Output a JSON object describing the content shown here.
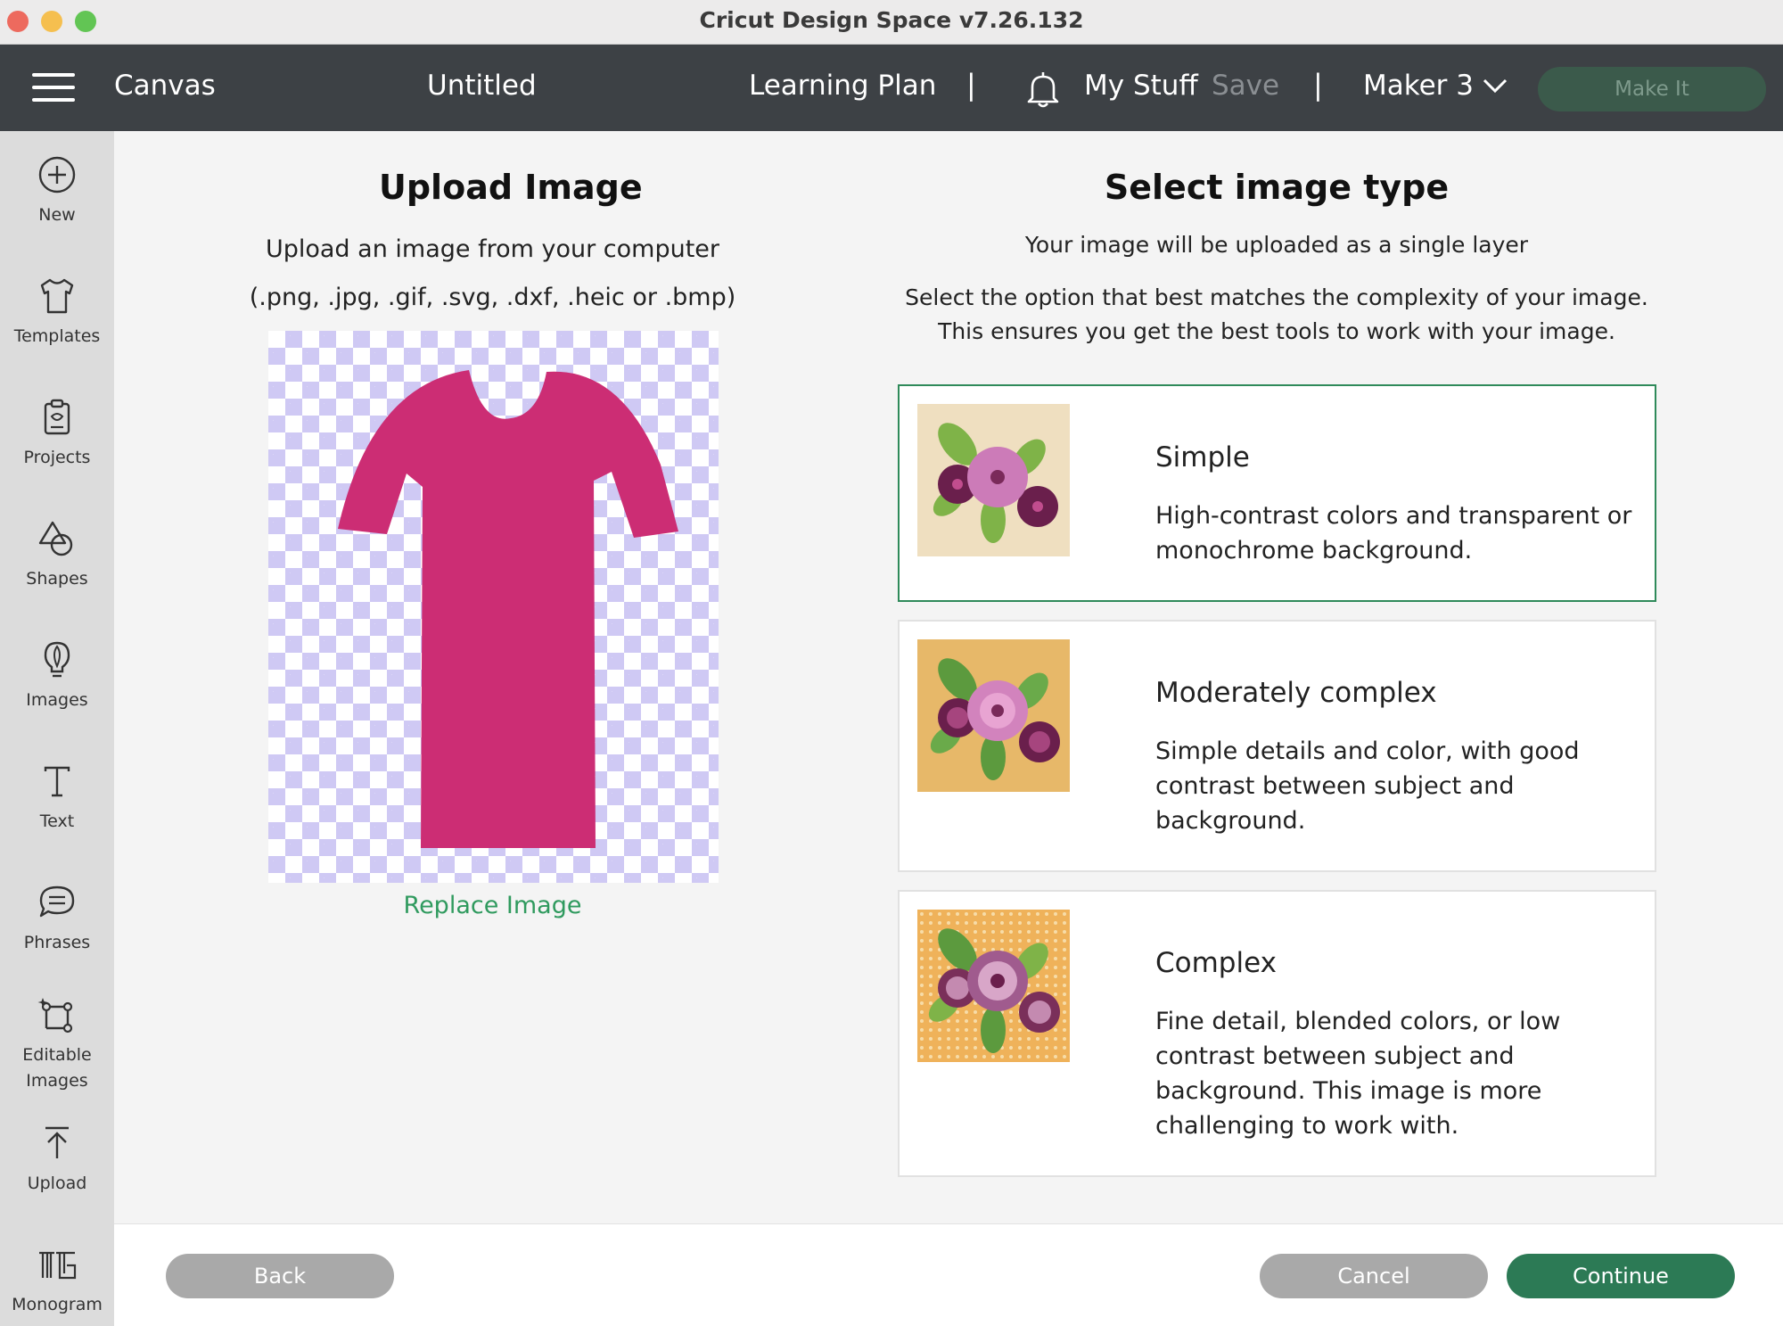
{
  "window": {
    "title": "Cricut Design Space  v7.26.132"
  },
  "header": {
    "canvas": "Canvas",
    "project_name": "Untitled",
    "learning_plan": "Learning Plan",
    "separator": "|",
    "my_stuff": "My Stuff",
    "save": "Save",
    "machine": "Maker 3",
    "make_it": "Make It"
  },
  "sidebar": {
    "items": [
      {
        "label": "New",
        "icon": "plus-circle-icon"
      },
      {
        "label": "Templates",
        "icon": "shirt-icon"
      },
      {
        "label": "Projects",
        "icon": "project-icon"
      },
      {
        "label": "Shapes",
        "icon": "shapes-icon"
      },
      {
        "label": "Images",
        "icon": "lightbulb-icon"
      },
      {
        "label": "Text",
        "icon": "text-icon"
      },
      {
        "label": "Phrases",
        "icon": "speech-bubble-icon"
      },
      {
        "label": "Editable Images",
        "label_line1": "Editable",
        "label_line2": "Images",
        "icon": "editable-image-icon"
      },
      {
        "label": "Upload",
        "icon": "upload-icon"
      },
      {
        "label": "Monogram",
        "icon": "monogram-icon"
      }
    ]
  },
  "upload": {
    "title": "Upload Image",
    "subtitle": "Upload an image from your computer",
    "formats": "(.png, .jpg, .gif, .svg, .dxf, .heic or .bmp)",
    "replace_link": "Replace Image",
    "preview_fill": "#cc2d74"
  },
  "select": {
    "title": "Select image type",
    "line1": "Your image will be uploaded as a single layer",
    "line2": "Select the option that best matches the complexity of your image.",
    "line3": "This ensures you get the best tools to work with your image.",
    "options": [
      {
        "title": "Simple",
        "desc": [
          "High-contrast colors and transparent or",
          "monochrome background."
        ],
        "selected": true,
        "thumb_bg": "#efdfc0"
      },
      {
        "title": "Moderately complex",
        "desc": [
          "Simple details and color, with good",
          "contrast between subject and",
          "background."
        ],
        "selected": false,
        "thumb_bg": "#e7b869"
      },
      {
        "title": "Complex",
        "desc": [
          "Fine detail, blended colors, or low",
          "contrast between subject and",
          "background. This image is more",
          "challenging to work with."
        ],
        "selected": false,
        "thumb_bg": "#efb25a"
      }
    ]
  },
  "footer": {
    "back": "Back",
    "cancel": "Cancel",
    "continue": "Continue"
  },
  "colors": {
    "accent": "#2c7a55",
    "header_bg": "#3d4145",
    "selected_border": "#2f8a5a"
  }
}
